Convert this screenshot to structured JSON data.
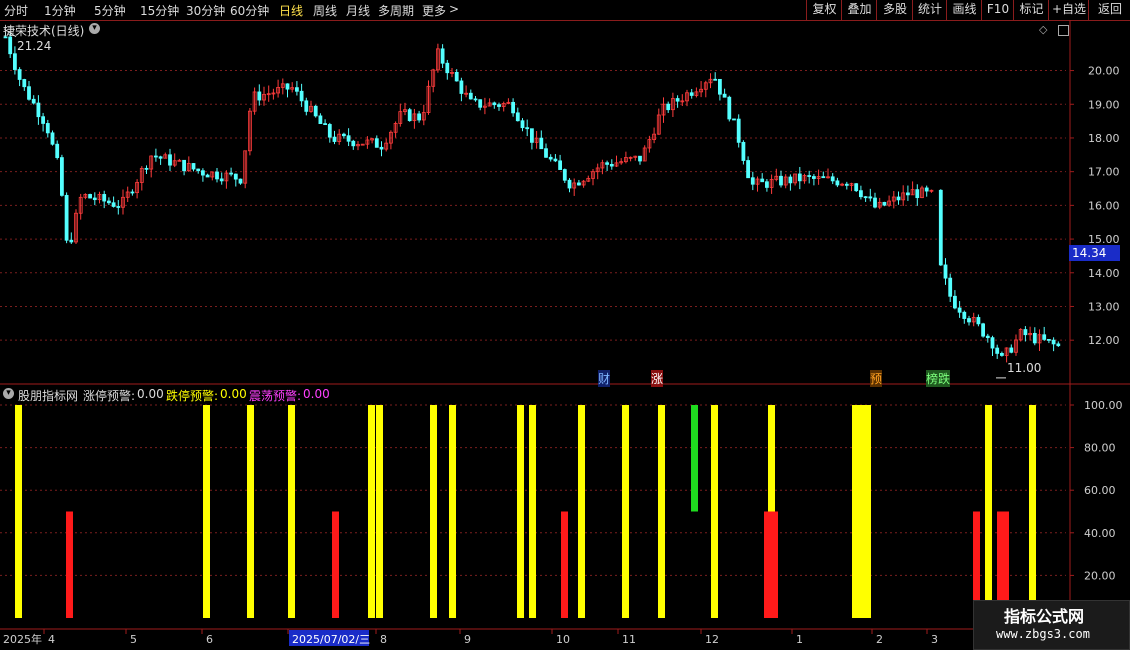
{
  "toolbar": {
    "periods": [
      "分时",
      "1分钟",
      "5分钟",
      "15分钟",
      "30分钟",
      "60分钟",
      "日线",
      "周线",
      "月线",
      "多周期",
      "更多"
    ],
    "active_period": "日线",
    "more_chevron": ">",
    "right_buttons": [
      "复权",
      "叠加",
      "多股",
      "统计",
      "画线",
      "F10",
      "标记",
      "+自选",
      "返回"
    ]
  },
  "colors": {
    "up": "#ff3c3c",
    "down": "#54ffff",
    "yellow": "#ffff00",
    "red": "#ff1a1a",
    "green": "#1fdc1f",
    "magenta": "#ff40ff",
    "grid": "#7a1e1e",
    "axis_text": "#cfcfcf"
  },
  "main_panel": {
    "title": "捷荣技术(日线)",
    "max_label": "21.24",
    "min_label": "11.00",
    "current_price": "14.34",
    "y_ticks": [
      "20.00",
      "19.00",
      "18.00",
      "17.00",
      "16.00",
      "15.00",
      "14.00",
      "13.00",
      "12.00"
    ],
    "event_tags": [
      "财",
      "涨",
      "预",
      "榜跌"
    ]
  },
  "indicator_panel": {
    "name": "股朋指标网",
    "up_label": "涨停预警:",
    "up_value": "0.00",
    "down_label": "跌停预警:",
    "down_value": "0.00",
    "osc_label": "震荡预警:",
    "osc_value": "0.00",
    "y_ticks": [
      "100.00",
      "80.00",
      "60.00",
      "40.00",
      "20.00"
    ]
  },
  "x_axis": {
    "labels": [
      "2025年",
      "4",
      "5",
      "6",
      "2025/07/02/三",
      "8",
      "9",
      "10",
      "11",
      "12",
      "1",
      "2",
      "3"
    ]
  },
  "watermark": {
    "line1": "指标公式网",
    "line2": "www.zbgs3.com"
  },
  "chart_data": {
    "type": "bar",
    "title": "捷荣技术(日线)",
    "price_range": [
      11.0,
      21.24
    ],
    "price_ylim": [
      10.7,
      21.5
    ],
    "indicator_ylim": [
      0,
      100
    ],
    "series": [
      {
        "name": "涨停预警",
        "color": "#ffff00",
        "values": [
          100,
          100,
          100,
          100,
          100,
          100,
          100,
          100,
          100,
          100,
          100,
          100,
          100,
          100,
          100,
          100,
          100,
          100,
          100,
          100,
          100,
          100,
          100,
          100,
          100
        ]
      },
      {
        "name": "跌停预警",
        "color": "#ff1a1a",
        "values": [
          50,
          50,
          50,
          50,
          50,
          50,
          50,
          50
        ]
      },
      {
        "name": "震荡预警",
        "color": "#1fdc1f",
        "values": [
          100
        ]
      }
    ],
    "x_index": {
      "yellow": [
        15,
        203,
        247,
        288,
        368,
        376,
        430,
        449,
        517,
        529,
        578,
        622,
        658,
        711,
        768,
        852,
        858,
        864,
        985,
        1029
      ],
      "red": [
        66,
        332,
        561,
        764,
        771,
        973,
        997,
        1002
      ],
      "green": [
        691
      ]
    }
  }
}
